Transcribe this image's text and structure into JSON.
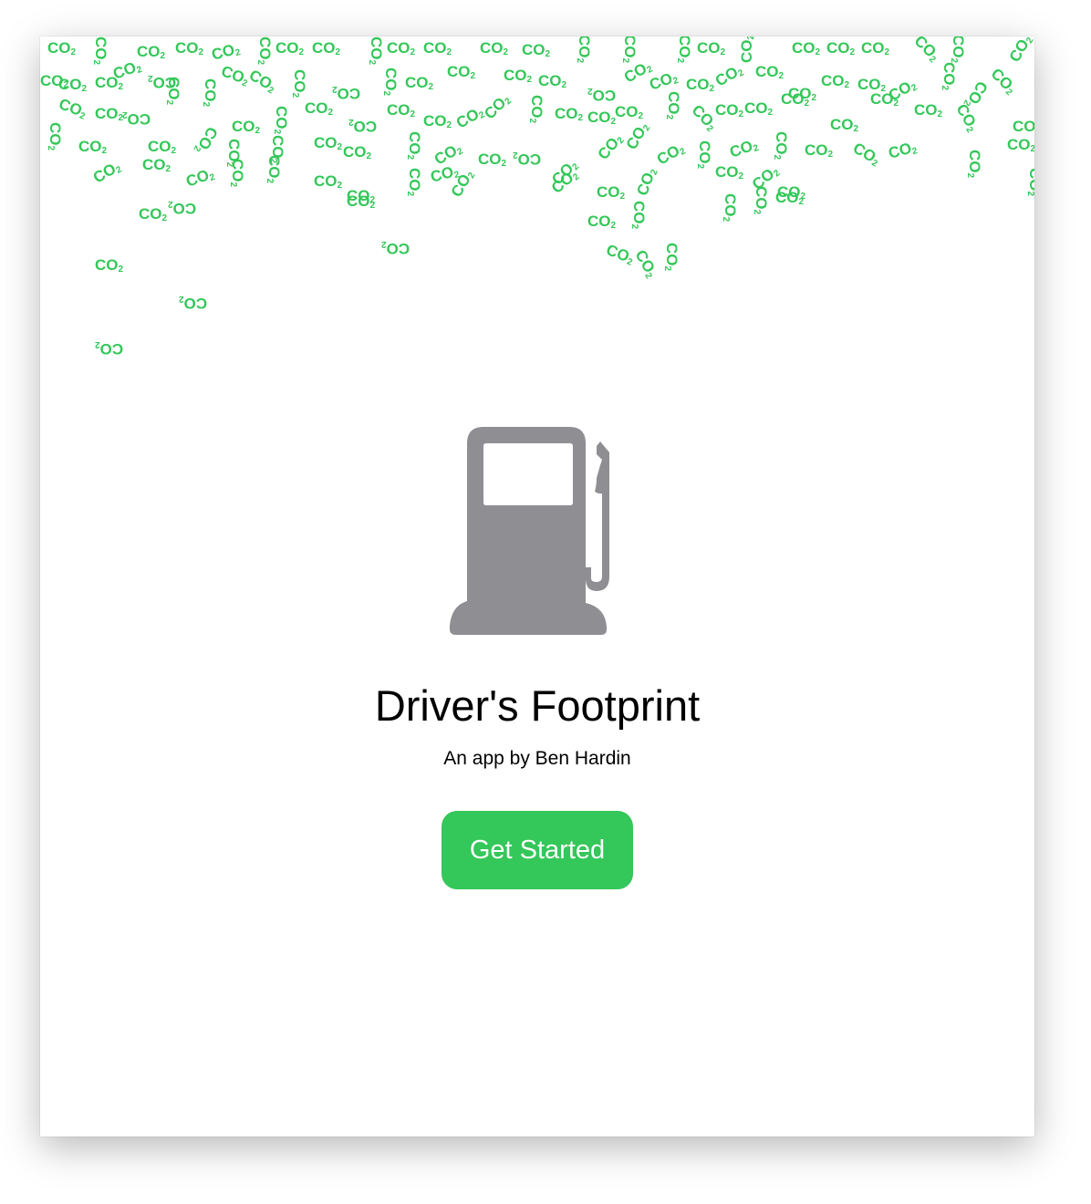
{
  "app": {
    "title": "Driver's Footprint",
    "subtitle": "An app by Ben Hardin",
    "primary_button_label": "Get Started",
    "icon": "fuel-pump-icon"
  },
  "decor": {
    "particle_text": "CO",
    "particle_subscript": "2"
  },
  "colors": {
    "accent_green": "#34C759",
    "icon_gray": "#8E8E93",
    "background": "#FFFFFF",
    "text": "#000000"
  }
}
